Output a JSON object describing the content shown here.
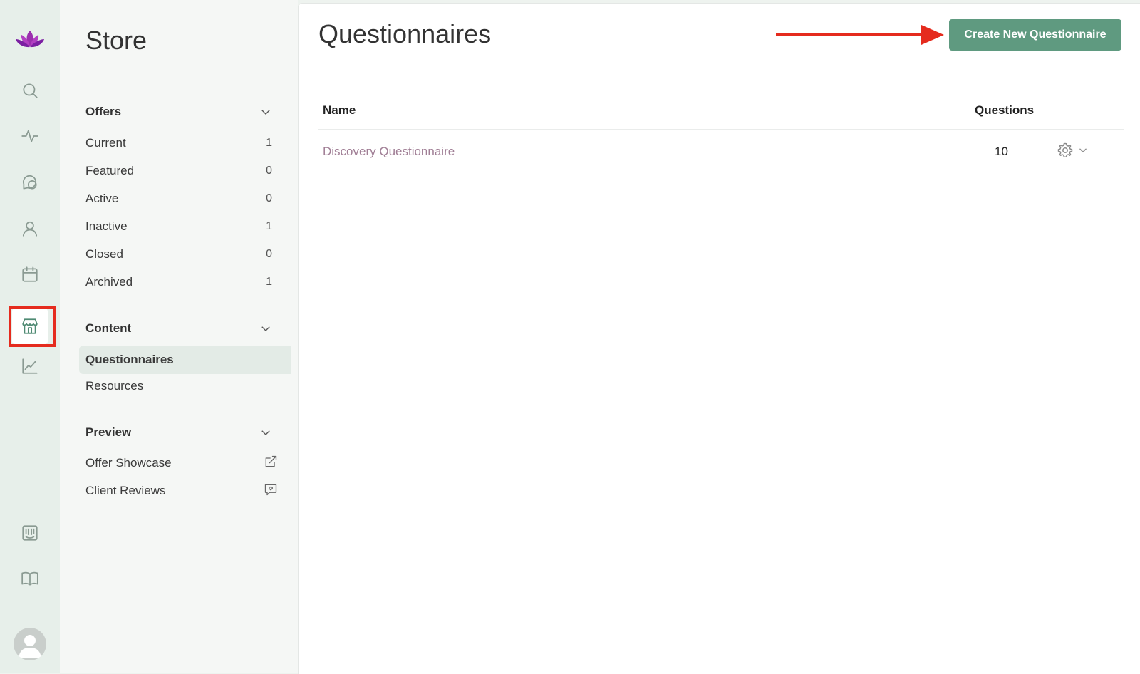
{
  "sidebar": {
    "title": "Store",
    "sections": [
      {
        "label": "Offers",
        "items": [
          {
            "label": "Current",
            "count": "1"
          },
          {
            "label": "Featured",
            "count": "0"
          },
          {
            "label": "Active",
            "count": "0"
          },
          {
            "label": "Inactive",
            "count": "1"
          },
          {
            "label": "Closed",
            "count": "0"
          },
          {
            "label": "Archived",
            "count": "1"
          }
        ]
      },
      {
        "label": "Content",
        "items": [
          {
            "label": "Questionnaires"
          },
          {
            "label": "Resources"
          }
        ]
      },
      {
        "label": "Preview",
        "items": [
          {
            "label": "Offer Showcase"
          },
          {
            "label": "Client Reviews"
          }
        ]
      }
    ]
  },
  "rail": {
    "icons": [
      "lotus-logo-icon",
      "search-icon",
      "activity-icon",
      "chat-icon",
      "person-icon",
      "calendar-icon",
      "store-icon",
      "chart-icon",
      "feedback-icon",
      "book-icon",
      "avatar-icon"
    ],
    "active": "store-icon"
  },
  "main": {
    "title": "Questionnaires",
    "create_button": "Create New Questionnaire",
    "table": {
      "columns": [
        "Name",
        "Questions"
      ],
      "rows": [
        {
          "name": "Discovery Questionnaire",
          "questions": "10"
        }
      ]
    }
  },
  "colors": {
    "accent": "#5f9a80",
    "link": "#a07e95",
    "annotation": "#e52b1e"
  }
}
